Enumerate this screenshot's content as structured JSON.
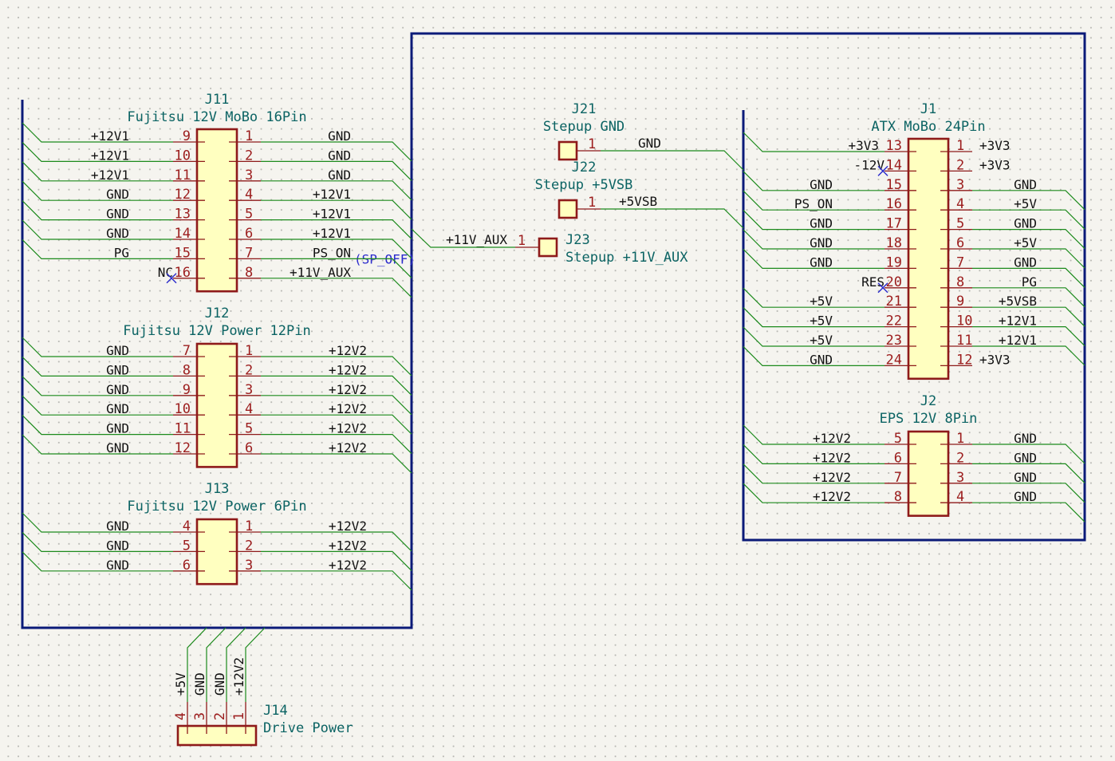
{
  "components": {
    "J11": {
      "ref": "J11",
      "value": "Fujitsu 12V MoBo 16Pin",
      "left": [
        {
          "n": "9",
          "net": "+12V1"
        },
        {
          "n": "10",
          "net": "+12V1"
        },
        {
          "n": "11",
          "net": "+12V1"
        },
        {
          "n": "12",
          "net": "GND"
        },
        {
          "n": "13",
          "net": "GND"
        },
        {
          "n": "14",
          "net": "GND"
        },
        {
          "n": "15",
          "net": "PG"
        },
        {
          "n": "16",
          "net": "NC"
        }
      ],
      "right": [
        {
          "n": "1",
          "net": "GND"
        },
        {
          "n": "2",
          "net": "GND"
        },
        {
          "n": "3",
          "net": "GND"
        },
        {
          "n": "4",
          "net": "+12V1"
        },
        {
          "n": "5",
          "net": "+12V1"
        },
        {
          "n": "6",
          "net": "+12V1"
        },
        {
          "n": "7",
          "net": "PS_ON",
          "alt": "(SP_OFF)"
        },
        {
          "n": "8",
          "net": "+11V_AUX"
        }
      ]
    },
    "J12": {
      "ref": "J12",
      "value": "Fujitsu 12V Power 12Pin",
      "left": [
        {
          "n": "7",
          "net": "GND"
        },
        {
          "n": "8",
          "net": "GND"
        },
        {
          "n": "9",
          "net": "GND"
        },
        {
          "n": "10",
          "net": "GND"
        },
        {
          "n": "11",
          "net": "GND"
        },
        {
          "n": "12",
          "net": "GND"
        }
      ],
      "right": [
        {
          "n": "1",
          "net": "+12V2"
        },
        {
          "n": "2",
          "net": "+12V2"
        },
        {
          "n": "3",
          "net": "+12V2"
        },
        {
          "n": "4",
          "net": "+12V2"
        },
        {
          "n": "5",
          "net": "+12V2"
        },
        {
          "n": "6",
          "net": "+12V2"
        }
      ]
    },
    "J13": {
      "ref": "J13",
      "value": "Fujitsu 12V Power 6Pin",
      "left": [
        {
          "n": "4",
          "net": "GND"
        },
        {
          "n": "5",
          "net": "GND"
        },
        {
          "n": "6",
          "net": "GND"
        }
      ],
      "right": [
        {
          "n": "1",
          "net": "+12V2"
        },
        {
          "n": "2",
          "net": "+12V2"
        },
        {
          "n": "3",
          "net": "+12V2"
        }
      ]
    },
    "J14": {
      "ref": "J14",
      "value": "Drive Power",
      "pins": [
        {
          "n": "4",
          "net": "+5V"
        },
        {
          "n": "3",
          "net": "GND"
        },
        {
          "n": "2",
          "net": "GND"
        },
        {
          "n": "1",
          "net": "+12V2"
        }
      ]
    },
    "J21": {
      "ref": "J21",
      "value": "Stepup GND",
      "pin": "1",
      "net": "GND"
    },
    "J22": {
      "ref": "J22",
      "value": "Stepup +5VSB",
      "pin": "1",
      "net": "+5VSB"
    },
    "J23": {
      "ref": "J23",
      "value": "Stepup +11V_AUX",
      "pin": "1",
      "net": "+11V_AUX"
    },
    "J1": {
      "ref": "J1",
      "value": "ATX MoBo 24Pin",
      "left": [
        {
          "n": "13",
          "net": "+3V3"
        },
        {
          "n": "14",
          "net": "-12V"
        },
        {
          "n": "15",
          "net": "GND"
        },
        {
          "n": "16",
          "net": "PS_ON"
        },
        {
          "n": "17",
          "net": "GND"
        },
        {
          "n": "18",
          "net": "GND"
        },
        {
          "n": "19",
          "net": "GND"
        },
        {
          "n": "20",
          "net": "RES"
        },
        {
          "n": "21",
          "net": "+5V"
        },
        {
          "n": "22",
          "net": "+5V"
        },
        {
          "n": "23",
          "net": "+5V"
        },
        {
          "n": "24",
          "net": "GND"
        }
      ],
      "right": [
        {
          "n": "1",
          "net": "+3V3"
        },
        {
          "n": "2",
          "net": "+3V3"
        },
        {
          "n": "3",
          "net": "GND"
        },
        {
          "n": "4",
          "net": "+5V"
        },
        {
          "n": "5",
          "net": "GND"
        },
        {
          "n": "6",
          "net": "+5V"
        },
        {
          "n": "7",
          "net": "GND"
        },
        {
          "n": "8",
          "net": "PG"
        },
        {
          "n": "9",
          "net": "+5VSB"
        },
        {
          "n": "10",
          "net": "+12V1"
        },
        {
          "n": "11",
          "net": "+12V1"
        },
        {
          "n": "12",
          "net": "+3V3"
        }
      ]
    },
    "J2": {
      "ref": "J2",
      "value": "EPS 12V 8Pin",
      "left": [
        {
          "n": "5",
          "net": "+12V2"
        },
        {
          "n": "6",
          "net": "+12V2"
        },
        {
          "n": "7",
          "net": "+12V2"
        },
        {
          "n": "8",
          "net": "+12V2"
        }
      ],
      "right": [
        {
          "n": "1",
          "net": "GND"
        },
        {
          "n": "2",
          "net": "GND"
        },
        {
          "n": "3",
          "net": "GND"
        },
        {
          "n": "4",
          "net": "GND"
        }
      ]
    }
  },
  "colors": {
    "bus": "#0a1a78",
    "wire": "#1c8a1c",
    "body": "#ffffc0",
    "outline": "#8e1a1a",
    "pin_number": "#9c1d1d",
    "reference": "#0b6363",
    "no_connect": "#2a2acc"
  }
}
